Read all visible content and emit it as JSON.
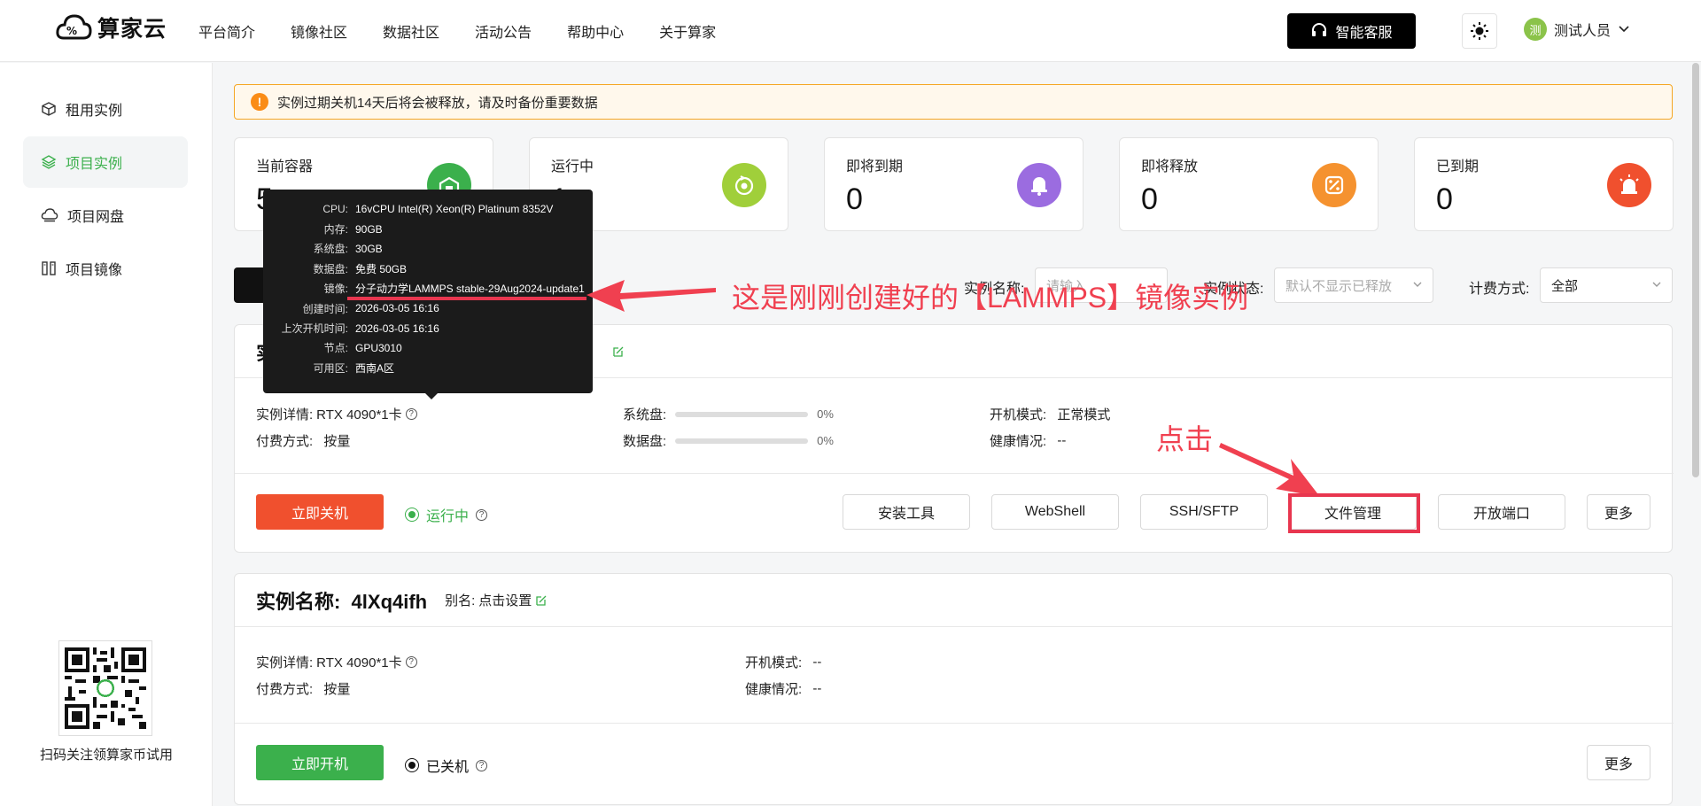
{
  "header": {
    "logo_text": "算家云",
    "nav": [
      "平台简介",
      "镜像社区",
      "数据社区",
      "活动公告",
      "帮助中心",
      "关于算家"
    ],
    "kefu_label": "智能客服",
    "user_name": "测试人员",
    "avatar_char": "测"
  },
  "sidebar": {
    "items": [
      {
        "label": "租用实例",
        "icon": "cube-icon"
      },
      {
        "label": "项目实例",
        "icon": "layers-icon"
      },
      {
        "label": "项目网盘",
        "icon": "cloud-disk-icon"
      },
      {
        "label": "项目镜像",
        "icon": "image-stack-icon"
      }
    ],
    "qr_caption": "扫码关注领算家币试用"
  },
  "notice": "实例过期关机14天后将会被释放，请及时备份重要数据",
  "stats": [
    {
      "label": "当前容器",
      "value": "5",
      "color": "#3bb04c",
      "icon": "container-icon"
    },
    {
      "label": "运行中",
      "value": "1",
      "color": "#a0cf3a",
      "icon": "running-icon"
    },
    {
      "label": "即将到期",
      "value": "0",
      "color": "#9b6ce0",
      "icon": "bell-icon"
    },
    {
      "label": "即将释放",
      "value": "0",
      "color": "#f5922f",
      "icon": "release-icon"
    },
    {
      "label": "已到期",
      "value": "0",
      "color": "#f0502e",
      "icon": "alarm-icon"
    }
  ],
  "filters": {
    "name_label": "实例名称:",
    "name_placeholder": "请输入",
    "status_label": "实例状态:",
    "status_placeholder": "默认不显示已释放",
    "billing_label": "计费方式:",
    "billing_value": "全部"
  },
  "tooltip": {
    "rows": [
      {
        "k": "CPU:",
        "v": "16vCPU Intel(R) Xeon(R) Platinum 8352V"
      },
      {
        "k": "内存:",
        "v": "90GB"
      },
      {
        "k": "系统盘:",
        "v": "30GB"
      },
      {
        "k": "数据盘:",
        "v": "免费 50GB"
      },
      {
        "k": "镜像:",
        "v": "分子动力学LAMMPS stable-29Aug2024-update1"
      },
      {
        "k": "创建时间:",
        "v": "2026-03-05 16:16"
      },
      {
        "k": "上次开机时间:",
        "v": "2026-03-05 16:16"
      },
      {
        "k": "节点:",
        "v": "GPU3010"
      },
      {
        "k": "可用区:",
        "v": "西南A区"
      }
    ]
  },
  "instance1": {
    "title": "实",
    "detail_label": "实例详情:",
    "detail_value": "RTX 4090*1卡",
    "pay_label": "付费方式:",
    "pay_value": "按量",
    "sysdisk_label": "系统盘:",
    "sysdisk_pct": "0%",
    "datadisk_label": "数据盘:",
    "datadisk_pct": "0%",
    "boot_label": "开机模式:",
    "boot_value": "正常模式",
    "health_label": "健康情况:",
    "health_value": "--",
    "action_btn": "立即关机",
    "status_text": "运行中",
    "buttons": [
      "安装工具",
      "WebShell",
      "SSH/SFTP",
      "文件管理",
      "开放端口",
      "更多"
    ]
  },
  "instance2": {
    "title": "实例名称:  4lXq4ifh",
    "alias_label": "别名:",
    "alias_value": "点击设置",
    "detail_label": "实例详情:",
    "detail_value": "RTX 4090*1卡",
    "pay_label": "付费方式:",
    "pay_value": "按量",
    "boot_label": "开机模式:",
    "boot_value": "--",
    "health_label": "健康情况:",
    "health_value": "--",
    "action_btn": "立即开机",
    "status_text": "已关机",
    "more_btn": "更多"
  },
  "annotations": {
    "arrow_text": "这是刚刚创建好的【LAMMPS】镜像实例",
    "click_text": "点击"
  },
  "colors": {
    "green": "#3bb04c",
    "red": "#f0502e",
    "annot": "#f04050"
  }
}
